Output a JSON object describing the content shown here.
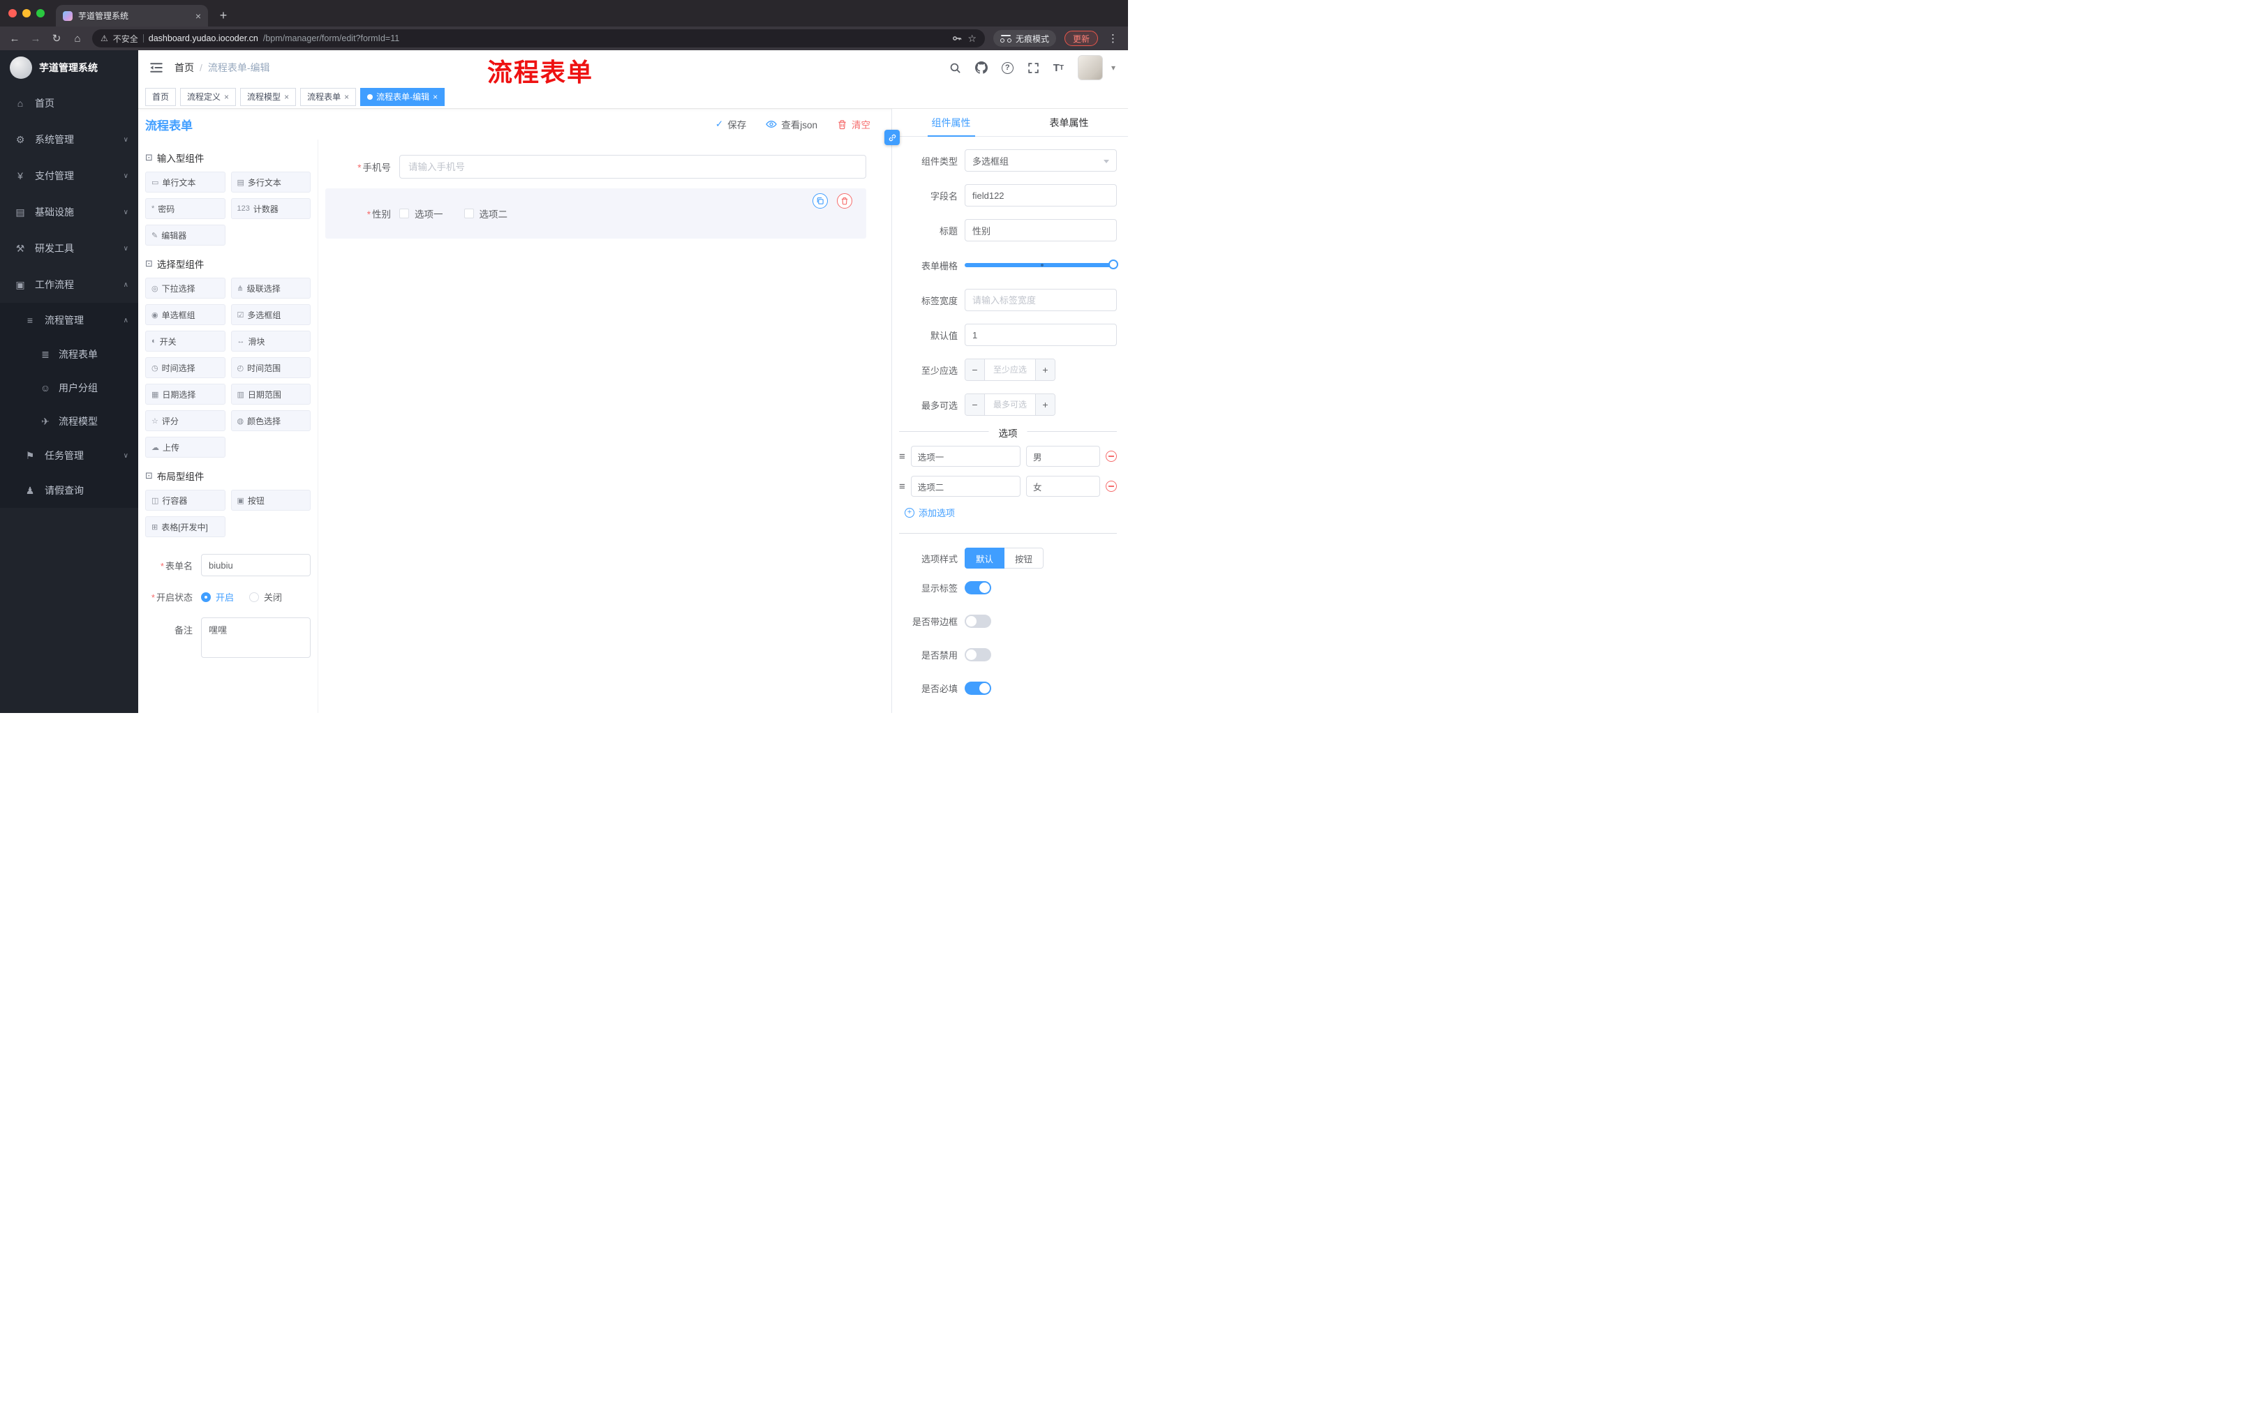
{
  "glyphs": {
    "back": "←",
    "forward": "→",
    "reload": "↻",
    "home": "⌂",
    "warning": "⚠",
    "star": "☆",
    "kebab": "⋮",
    "new_tab": "+",
    "close": "×",
    "caret_down": "▾",
    "check": "✓",
    "chevron_up": "∧",
    "chevron_down": "∨",
    "breadcrumb_sep": "/",
    "plus": "+",
    "minus": "−",
    "drag": "≡",
    "section": "⊡",
    "question": "?"
  },
  "browser": {
    "tab_title": "芋道管理系统",
    "security": "不安全",
    "url_host": "dashboard.yudao.iocoder.cn",
    "url_path": "/bpm/manager/form/edit?formId=11",
    "incognito": "无痕模式",
    "update": "更新"
  },
  "sidebar": {
    "logo_title": "芋道管理系统",
    "top_items": [
      {
        "label": "首页",
        "glyph": "⌂"
      },
      {
        "label": "系统管理",
        "glyph": "⚙"
      },
      {
        "label": "支付管理",
        "glyph": "¥"
      },
      {
        "label": "基础设施",
        "glyph": "▤"
      },
      {
        "label": "研发工具",
        "glyph": "⚒"
      },
      {
        "label": "工作流程",
        "glyph": "▣"
      }
    ],
    "process_group": {
      "label": "流程管理",
      "glyph": "≡"
    },
    "process_children": [
      {
        "label": "流程表单",
        "glyph": "≣"
      },
      {
        "label": "用户分组",
        "glyph": "☺"
      },
      {
        "label": "流程模型",
        "glyph": "✈"
      }
    ],
    "task_group": {
      "label": "任务管理",
      "glyph": "⚑"
    },
    "leave_item": {
      "label": "请假查询",
      "glyph": "♟"
    }
  },
  "header": {
    "breadcrumb_home": "首页",
    "breadcrumb_current": "流程表单-编辑",
    "annotation": "流程表单"
  },
  "tags": [
    {
      "label": "首页"
    },
    {
      "label": "流程定义"
    },
    {
      "label": "流程模型"
    },
    {
      "label": "流程表单"
    },
    {
      "label": "流程表单-编辑"
    }
  ],
  "toolbar": {
    "title": "流程表单",
    "save": "保存",
    "view_json": "查看json",
    "clear": "清空"
  },
  "palette": {
    "sections": [
      {
        "title": "输入型组件",
        "items": [
          {
            "label": "单行文本",
            "glyph": "▭"
          },
          {
            "label": "多行文本",
            "glyph": "▤"
          },
          {
            "label": "密码",
            "glyph": "*"
          },
          {
            "label": "计数器",
            "glyph": "123"
          },
          {
            "label": "编辑器",
            "glyph": "✎"
          }
        ]
      },
      {
        "title": "选择型组件",
        "items": [
          {
            "label": "下拉选择",
            "glyph": "◎"
          },
          {
            "label": "级联选择",
            "glyph": "⋔"
          },
          {
            "label": "单选框组",
            "glyph": "◉"
          },
          {
            "label": "多选框组",
            "glyph": "☑"
          },
          {
            "label": "开关",
            "glyph": "◐"
          },
          {
            "label": "滑块",
            "glyph": "↔"
          },
          {
            "label": "时间选择",
            "glyph": "◷"
          },
          {
            "label": "时间范围",
            "glyph": "◴"
          },
          {
            "label": "日期选择",
            "glyph": "▦"
          },
          {
            "label": "日期范围",
            "glyph": "▥"
          },
          {
            "label": "评分",
            "glyph": "☆"
          },
          {
            "label": "颜色选择",
            "glyph": "◍"
          },
          {
            "label": "上传",
            "glyph": "☁"
          }
        ]
      },
      {
        "title": "布局型组件",
        "items": [
          {
            "label": "行容器",
            "glyph": "◫"
          },
          {
            "label": "按钮",
            "glyph": "▣"
          },
          {
            "label": "表格[开发中]",
            "glyph": "⊞"
          }
        ]
      }
    ],
    "form": {
      "name_label": "表单名",
      "name_value": "biubiu",
      "status_label": "开启状态",
      "status_on": "开启",
      "status_off": "关闭",
      "remark_label": "备注",
      "remark_value": "嘿嘿"
    }
  },
  "canvas": {
    "phone_label": "手机号",
    "phone_placeholder": "请输入手机号",
    "gender_label": "性别",
    "gender_options": [
      "选项一",
      "选项二"
    ]
  },
  "panel": {
    "tab_component": "组件属性",
    "tab_form": "表单属性",
    "component_type_label": "组件类型",
    "component_type_value": "多选框组",
    "field_label": "字段名",
    "field_value": "field122",
    "title_label": "标题",
    "title_value": "性别",
    "grid_label": "表单栅格",
    "label_width_label": "标签宽度",
    "label_width_placeholder": "请输入标签宽度",
    "default_label": "默认值",
    "default_value": "1",
    "min_label": "至少应选",
    "min_placeholder": "至少应选",
    "max_label": "最多可选",
    "max_placeholder": "最多可选",
    "options_title": "选项",
    "options": [
      {
        "name": "选项一",
        "value": "男"
      },
      {
        "name": "选项二",
        "value": "女"
      }
    ],
    "add_option": "添加选项",
    "style_label": "选项样式",
    "style_default": "默认",
    "style_button": "按钮",
    "switch_show_label": "显示标签",
    "switch_border": "是否带边框",
    "switch_disabled": "是否禁用",
    "switch_required": "是否必填"
  },
  "colors": {
    "primary": "#409eff",
    "danger": "#f56c6c"
  }
}
